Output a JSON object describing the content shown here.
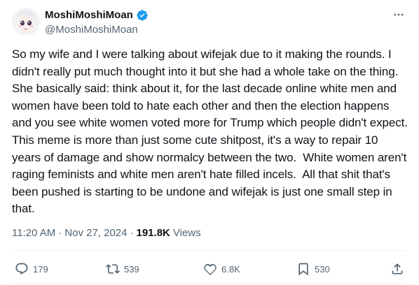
{
  "author": {
    "display_name": "MoshiMoshiMoan",
    "handle": "@MoshiMoshiMoan",
    "verified": true
  },
  "tweet": {
    "text": "So my wife and I were talking about wifejak due to it making the rounds. I didn't really put much thought into it but she had a whole take on the thing.  She basically said: think about it, for the last decade online white men and women have been told to hate each other and then the election happens and you see white women voted more for Trump which people didn't expect.  This meme is more than just some cute shitpost, it's a way to repair 10 years of damage and show normalcy between the two.  White women aren't raging feminists and white men aren't hate filled incels.  All that shit that's been pushed is starting to be undone and wifejak is just one small step in that.",
    "time": "11:20 AM",
    "date": "Nov 27, 2024",
    "separator": "·",
    "views_count": "191.8K",
    "views_label": "Views"
  },
  "actions": {
    "replies": "179",
    "retweets": "539",
    "likes": "6.8K",
    "bookmarks": "530"
  },
  "colors": {
    "verified": "#1d9bf0",
    "muted": "#536471",
    "text": "#0f1419",
    "divider": "#eff3f4"
  },
  "icons": [
    "more-icon",
    "verified-badge-icon",
    "reply-icon",
    "retweet-icon",
    "like-icon",
    "bookmark-icon",
    "share-icon"
  ]
}
